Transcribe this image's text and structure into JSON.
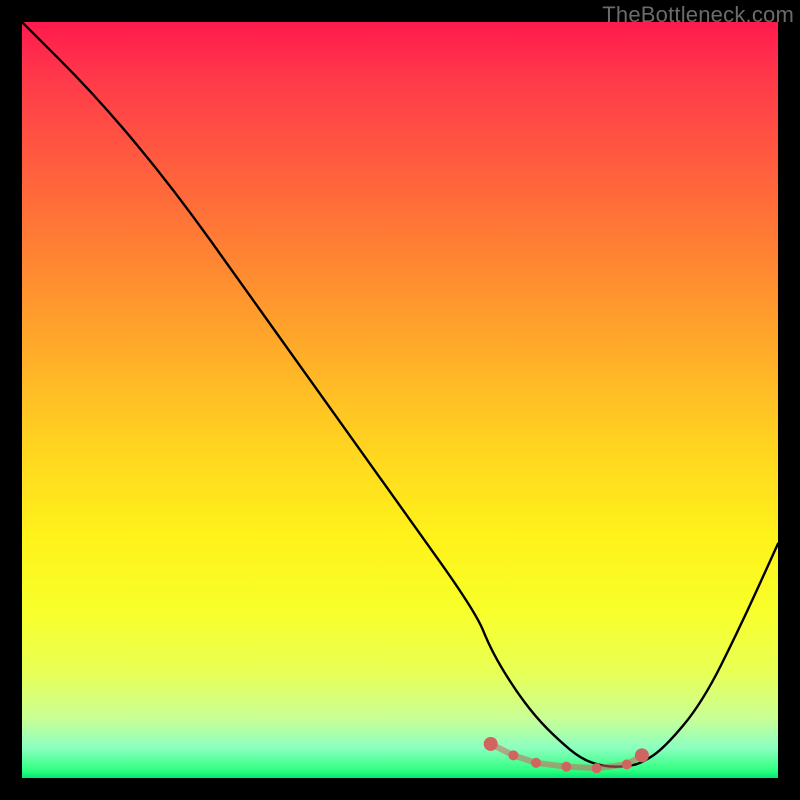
{
  "watermark": {
    "text": "TheBottleneck.com"
  },
  "chart_data": {
    "type": "line",
    "title": "",
    "xlabel": "",
    "ylabel": "",
    "xlim": [
      0,
      100
    ],
    "ylim": [
      0,
      100
    ],
    "grid": false,
    "series": [
      {
        "name": "curve",
        "color": "#000000",
        "x": [
          0,
          10,
          20,
          30,
          35,
          40,
          50,
          60,
          62,
          65,
          68,
          71,
          74,
          77,
          80,
          82,
          85,
          90,
          95,
          100
        ],
        "values": [
          100,
          90,
          78,
          64,
          57,
          50,
          36,
          22,
          17,
          12,
          8,
          5,
          2.5,
          1.5,
          1.5,
          2,
          4,
          10,
          20,
          31
        ]
      }
    ],
    "markers": {
      "name": "min-band",
      "color": "#d0645f",
      "style": "dots-on-curve",
      "x": [
        62,
        65,
        68,
        72,
        76,
        80,
        82
      ],
      "values": [
        4.5,
        3,
        2,
        1.5,
        1.3,
        1.8,
        3
      ]
    },
    "background_gradient": {
      "orientation": "vertical",
      "stops": [
        {
          "pos": 0,
          "color": "#ff1a4d"
        },
        {
          "pos": 50,
          "color": "#ffd020"
        },
        {
          "pos": 80,
          "color": "#f5ff3a"
        },
        {
          "pos": 100,
          "color": "#00e874"
        }
      ]
    }
  }
}
